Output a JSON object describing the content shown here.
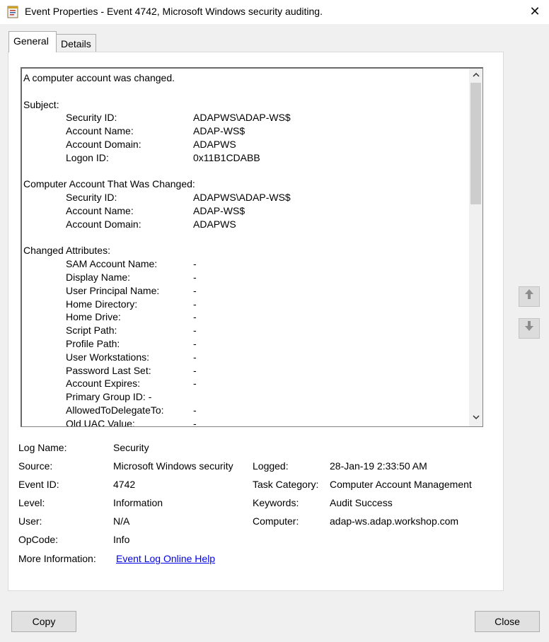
{
  "window": {
    "title": "Event Properties - Event 4742, Microsoft Windows security auditing.",
    "close_glyph": "✕"
  },
  "tabs": [
    {
      "label": "General",
      "active": true
    },
    {
      "label": "Details",
      "active": false
    }
  ],
  "description": {
    "lines": [
      {
        "text": "A computer account was changed."
      },
      {
        "text": ""
      },
      {
        "text": "Subject:"
      },
      {
        "label": "Security ID:",
        "value": "ADAPWS\\ADAP-WS$"
      },
      {
        "label": "Account Name:",
        "value": "ADAP-WS$"
      },
      {
        "label": "Account Domain:",
        "value": "ADAPWS"
      },
      {
        "label": "Logon ID:",
        "value": "0x11B1CDABB"
      },
      {
        "text": ""
      },
      {
        "text": "Computer Account That Was Changed:"
      },
      {
        "label": "Security ID:",
        "value": "ADAPWS\\ADAP-WS$"
      },
      {
        "label": "Account Name:",
        "value": "ADAP-WS$"
      },
      {
        "label": "Account Domain:",
        "value": "ADAPWS"
      },
      {
        "text": ""
      },
      {
        "text": "Changed Attributes:"
      },
      {
        "label": "SAM Account Name:",
        "value": "-"
      },
      {
        "label": "Display Name:",
        "value": "-"
      },
      {
        "label": "User Principal Name:",
        "value": "-"
      },
      {
        "label": "Home Directory:",
        "value": "-"
      },
      {
        "label": "Home Drive:",
        "value": "-"
      },
      {
        "label": "Script Path:",
        "value": "-"
      },
      {
        "label": "Profile Path:",
        "value": "-"
      },
      {
        "label": "User Workstations:",
        "value": "-"
      },
      {
        "label": "Password Last Set:",
        "value": "-"
      },
      {
        "label": "Account Expires:",
        "value": "-"
      },
      {
        "label": "Primary Group ID: -",
        "value": ""
      },
      {
        "label": "AllowedToDelegateTo:",
        "value": "-"
      },
      {
        "label": "Old UAC Value:",
        "value": "-"
      }
    ]
  },
  "fields": {
    "log_name": {
      "label": "Log Name:",
      "value": "Security"
    },
    "source": {
      "label": "Source:",
      "value": "Microsoft Windows security"
    },
    "logged": {
      "label": "Logged:",
      "value": "28-Jan-19 2:33:50 AM"
    },
    "event_id": {
      "label": "Event ID:",
      "value": "4742"
    },
    "task_category": {
      "label": "Task Category:",
      "value": "Computer Account Management"
    },
    "level": {
      "label": "Level:",
      "value": "Information"
    },
    "keywords": {
      "label": "Keywords:",
      "value": "Audit Success"
    },
    "user": {
      "label": "User:",
      "value": "N/A"
    },
    "computer": {
      "label": "Computer:",
      "value": "adap-ws.adap.workshop.com"
    },
    "opcode": {
      "label": "OpCode:",
      "value": "Info"
    },
    "more_info": {
      "label": "More Information:",
      "link": "Event Log Online Help"
    }
  },
  "buttons": {
    "copy": "Copy",
    "close": "Close",
    "up_glyph": "🡅",
    "down_glyph": "🡇"
  },
  "scroll": {
    "up_glyph": "^",
    "down_glyph": "v"
  }
}
